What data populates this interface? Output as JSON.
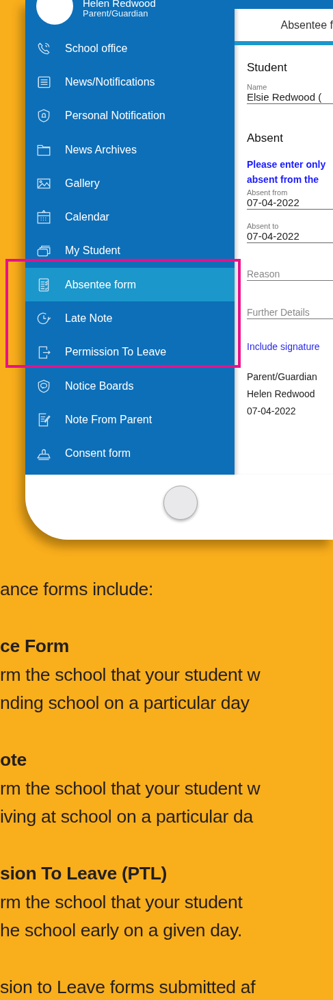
{
  "profile": {
    "name": "Helen Redwood",
    "role": "Parent/Guardian"
  },
  "menu": [
    {
      "label": "School office",
      "selected": false
    },
    {
      "label": "News/Notifications",
      "selected": false
    },
    {
      "label": "Personal Notification",
      "selected": false
    },
    {
      "label": "News Archives",
      "selected": false
    },
    {
      "label": "Gallery",
      "selected": false
    },
    {
      "label": "Calendar",
      "selected": false
    },
    {
      "label": "My Student",
      "selected": false
    },
    {
      "label": "Absentee form",
      "selected": true
    },
    {
      "label": "Late Note",
      "selected": false
    },
    {
      "label": "Permission To Leave",
      "selected": false
    },
    {
      "label": "Notice Boards",
      "selected": false
    },
    {
      "label": "Note From Parent",
      "selected": false
    },
    {
      "label": "Consent form",
      "selected": false
    }
  ],
  "form": {
    "title": "Absentee f",
    "student_heading": "Student",
    "name_label": "Name",
    "name_value": "Elsie Redwood (",
    "absent_heading": "Absent",
    "notice_lines": [
      "Please enter only",
      "absent from the"
    ],
    "absent_from_label": "Absent from",
    "absent_from_value": "07-04-2022",
    "absent_to_label": "Absent to",
    "absent_to_value": "07-04-2022",
    "reason_placeholder": "Reason",
    "details_placeholder": "Further Details",
    "signature_link": "Include signature",
    "signer_heading": "Parent/Guardian",
    "signer_name": "Helen Redwood",
    "signed_date": "07-04-2022"
  },
  "article": {
    "intro": "ance forms include:",
    "sections": [
      {
        "heading": "ce Form",
        "lines": [
          "rm the school that your student w",
          "nding school on a particular day"
        ]
      },
      {
        "heading": "ote",
        "lines": [
          "rm the school that your student w",
          "iving at school on a particular da"
        ]
      },
      {
        "heading": "sion To Leave (PTL)",
        "lines": [
          "rm the school that your student",
          "he school early on a given day."
        ]
      }
    ],
    "footer": "sion to Leave forms submitted af"
  }
}
